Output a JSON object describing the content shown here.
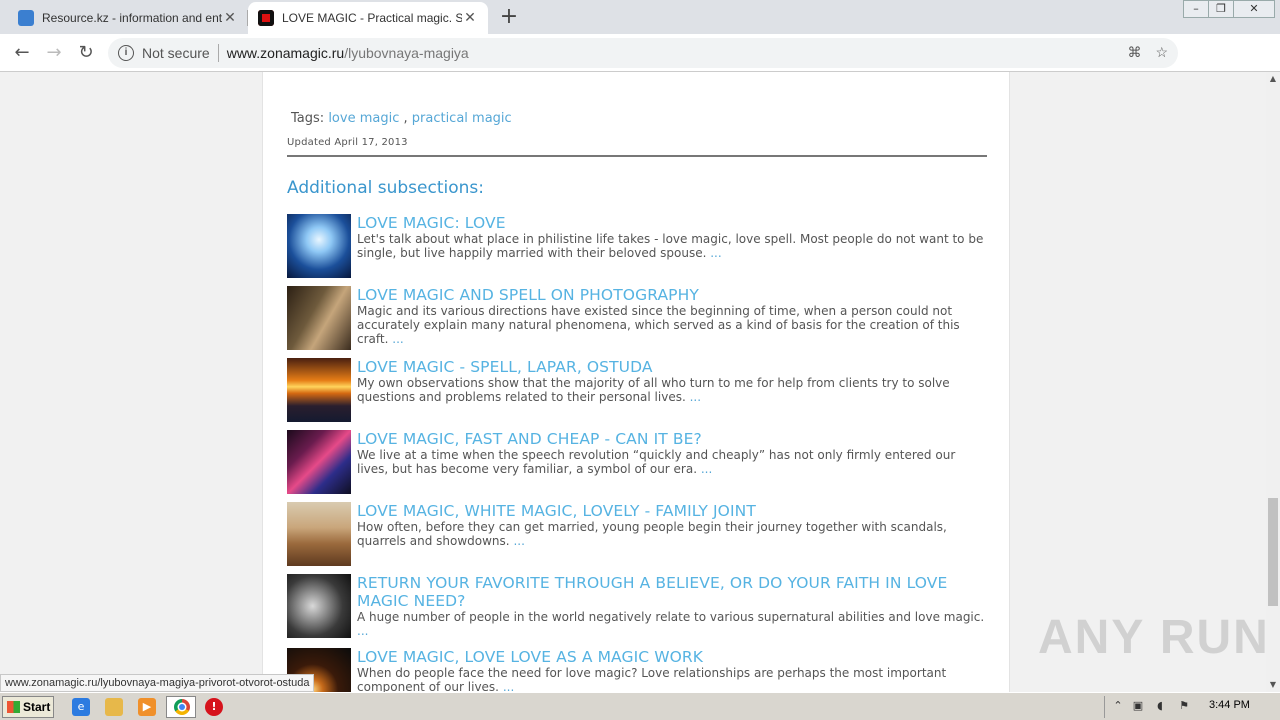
{
  "browser": {
    "tabs": [
      {
        "title": "Resource.kz - information and enter",
        "favicon": "ie-page-icon"
      },
      {
        "title": "LOVE MAGIC - Practical magic. Servi",
        "favicon": "zonamagic-icon"
      }
    ],
    "new_tab_label": "+",
    "security_label": "Not secure",
    "url_host": "www.zonamagic.ru",
    "url_path": "/lyubovnaya-magiya",
    "status_url": "www.zonamagic.ru/lyubovnaya-magiya-privorot-otvorot-ostuda"
  },
  "page": {
    "tags_label": "Tags:",
    "tags": [
      "love magic",
      "practical magic"
    ],
    "tag_sep": ",",
    "updated": "Updated April 17, 2013",
    "subsections_heading": "Additional subsections:",
    "items": [
      {
        "title": "LOVE MAGIC: LOVE",
        "desc": "Let's talk about what place in philistine life takes - love magic, love spell. Most people do not want to be single, but live happily married with their beloved spouse.",
        "more": "..."
      },
      {
        "title": "LOVE MAGIC AND SPELL ON PHOTOGRAPHY",
        "desc": "Magic and its various directions have existed since the beginning of time, when a person could not accurately explain many natural phenomena, which served as a kind of basis for the creation of this craft.",
        "more": "..."
      },
      {
        "title": "LOVE MAGIC - SPELL, LAPAR, OSTUDA",
        "desc": "My own observations show that the majority of all who turn to me for help from clients try to solve questions and problems related to their personal lives.",
        "more": "..."
      },
      {
        "title": "LOVE MAGIC, FAST AND CHEAP - CAN IT BE?",
        "desc": "We live at a time when the speech revolution “quickly and cheaply” has not only firmly entered our lives, but has become very familiar, a symbol of our era.",
        "more": "..."
      },
      {
        "title": "LOVE MAGIC, WHITE MAGIC, LOVELY - FAMILY JOINT",
        "desc": "How often, before they can get married, young people begin their journey together with scandals, quarrels and showdowns.",
        "more": "..."
      },
      {
        "title": "RETURN YOUR FAVORITE THROUGH A BELIEVE, OR DO YOUR FAITH IN LOVE MAGIC NEED?",
        "desc": "A huge number of people in the world negatively relate to various supernatural abilities and love magic.",
        "more": "..."
      },
      {
        "title": "LOVE MAGIC, LOVE LOVE AS A MAGIC WORK",
        "desc": "When do people face the need for love magic? Love relationships are perhaps the most important component of our lives.",
        "more": "..."
      }
    ]
  },
  "watermark": "ANY RUN",
  "taskbar": {
    "start_label": "Start",
    "clock": "3:44 PM"
  },
  "colors": {
    "link": "#56a7d6",
    "title": "#56b3e2",
    "heading": "#3a96cd"
  }
}
